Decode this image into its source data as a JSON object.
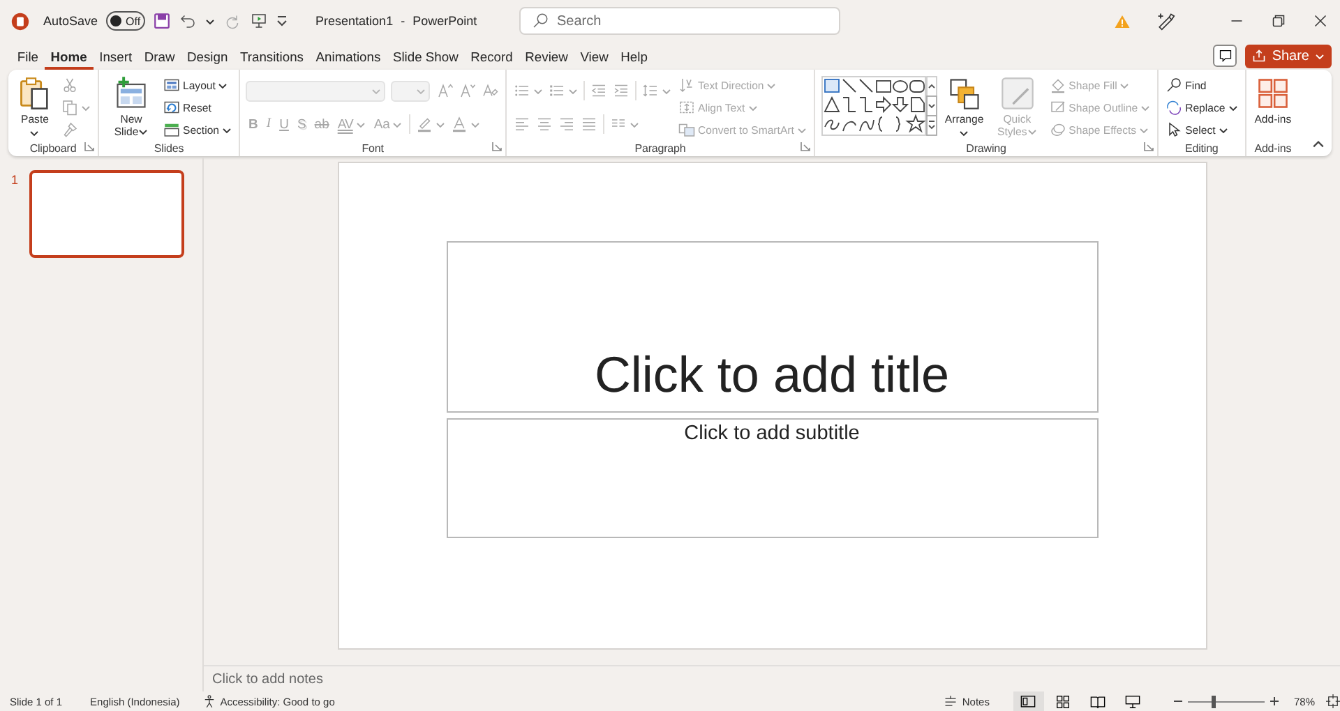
{
  "title_bar": {
    "autosave": {
      "label": "AutoSave",
      "on": false,
      "state_text": "Off"
    },
    "title": "Presentation1 - PowerPoint",
    "search": {
      "placeholder": "Search"
    }
  },
  "tabs": [
    {
      "label": "File",
      "selected": false
    },
    {
      "label": "Home",
      "selected": true
    },
    {
      "label": "Insert",
      "selected": false
    },
    {
      "label": "Draw",
      "selected": false
    },
    {
      "label": "Design",
      "selected": false
    },
    {
      "label": "Transitions",
      "selected": false
    },
    {
      "label": "Animations",
      "selected": false
    },
    {
      "label": "Slide Show",
      "selected": false
    },
    {
      "label": "Record",
      "selected": false
    },
    {
      "label": "Review",
      "selected": false
    },
    {
      "label": "View",
      "selected": false
    },
    {
      "label": "Help",
      "selected": false
    }
  ],
  "share": {
    "label": "Share"
  },
  "ribbon": {
    "groups": [
      {
        "label": "Clipboard",
        "launcher": true,
        "columns": [
          [
            [
              {
                "kind": "large",
                "label": "Paste",
                "dropdown": true,
                "disabled": false
              }
            ]
          ],
          [
            [
              {
                "kind": "icon",
                "dropdown": false,
                "disabled": true
              }
            ],
            [
              {
                "kind": "icon",
                "dropdown": true,
                "disabled": true
              }
            ],
            [
              {
                "kind": "icon",
                "dropdown": false,
                "disabled": true
              }
            ]
          ]
        ]
      },
      {
        "label": "Slides",
        "launcher": false,
        "columns": [
          [
            [
              {
                "kind": "large",
                "label": "New Slide",
                "dropdown": true,
                "disabled": false
              }
            ]
          ],
          [
            [
              {
                "kind": "small",
                "label": "Layout",
                "dropdown": true,
                "disabled": false
              }
            ],
            [
              {
                "kind": "small",
                "label": "Reset",
                "dropdown": false,
                "disabled": false
              }
            ],
            [
              {
                "kind": "small",
                "label": "Section",
                "dropdown": true,
                "disabled": false
              }
            ]
          ]
        ]
      },
      {
        "label": "Font",
        "launcher": true,
        "columns": [
          [
            [
              {
                "kind": "combo",
                "dropdown": true,
                "disabled": true
              },
              {
                "kind": "combo",
                "dropdown": true,
                "disabled": true
              },
              {
                "kind": "icon",
                "dropdown": false,
                "disabled": true
              },
              {
                "kind": "icon",
                "dropdown": false,
                "disabled": true
              },
              {
                "kind": "icon",
                "dropdown": false,
                "disabled": true
              }
            ],
            [
              {
                "kind": "glyph",
                "label": "B",
                "dropdown": false,
                "disabled": true
              },
              {
                "kind": "glyph",
                "label": "I",
                "dropdown": false,
                "disabled": true
              },
              {
                "kind": "glyph",
                "label": "U",
                "dropdown": false,
                "disabled": true
              },
              {
                "kind": "glyph",
                "label": "S",
                "dropdown": false,
                "disabled": true
              },
              {
                "kind": "glyph",
                "label": "ab",
                "dropdown": false,
                "disabled": true
              },
              {
                "kind": "glyph",
                "label": "AV",
                "dropdown": true,
                "disabled": true
              },
              {
                "kind": "glyph",
                "label": "Aa",
                "dropdown": true,
                "disabled": true
              },
              {
                "kind": "sep"
              },
              {
                "kind": "icon",
                "dropdown": true,
                "disabled": true
              },
              {
                "kind": "icon",
                "dropdown": true,
                "disabled": true
              }
            ]
          ]
        ]
      },
      {
        "label": "Paragraph",
        "launcher": true,
        "columns": [
          [
            [
              {
                "kind": "icon",
                "dropdown": true,
                "disabled": true
              },
              {
                "kind": "icon",
                "dropdown": true,
                "disabled": true
              },
              {
                "kind": "sep"
              },
              {
                "kind": "icon",
                "dropdown": false,
                "disabled": true
              },
              {
                "kind": "icon",
                "dropdown": false,
                "disabled": true
              },
              {
                "kind": "sep"
              },
              {
                "kind": "icon",
                "dropdown": true,
                "disabled": true
              }
            ],
            [
              {
                "kind": "icon",
                "dropdown": false,
                "disabled": true
              },
              {
                "kind": "icon",
                "dropdown": false,
                "disabled": true
              },
              {
                "kind": "icon",
                "dropdown": false,
                "disabled": true
              },
              {
                "kind": "icon",
                "dropdown": false,
                "disabled": true
              },
              {
                "kind": "sep"
              },
              {
                "kind": "icon",
                "dropdown": true,
                "disabled": true
              }
            ]
          ],
          [
            [
              {
                "kind": "small",
                "label": "Text Direction",
                "dropdown": true,
                "disabled": true
              }
            ],
            [
              {
                "kind": "small",
                "label": "Align Text",
                "dropdown": true,
                "disabled": true
              }
            ],
            [
              {
                "kind": "small",
                "label": "Convert to SmartArt",
                "dropdown": true,
                "disabled": true
              }
            ]
          ]
        ]
      },
      {
        "label": "Drawing",
        "launcher": true,
        "columns": [
          [
            [
              {
                "kind": "gallery"
              }
            ]
          ],
          [
            [
              {
                "kind": "large",
                "label": "Arrange",
                "dropdown": true,
                "disabled": false
              }
            ]
          ],
          [
            [
              {
                "kind": "large",
                "label": "Quick Styles",
                "dropdown": true,
                "disabled": true
              }
            ]
          ],
          [
            [
              {
                "kind": "small",
                "label": "Shape Fill",
                "dropdown": true,
                "disabled": true
              }
            ],
            [
              {
                "kind": "small",
                "label": "Shape Outline",
                "dropdown": true,
                "disabled": true
              }
            ],
            [
              {
                "kind": "small",
                "label": "Shape Effects",
                "dropdown": true,
                "disabled": true
              }
            ]
          ]
        ]
      },
      {
        "label": "Editing",
        "launcher": false,
        "columns": [
          [
            [
              {
                "kind": "small",
                "label": "Find",
                "dropdown": false,
                "disabled": false
              }
            ],
            [
              {
                "kind": "small",
                "label": "Replace",
                "dropdown": true,
                "disabled": false
              }
            ],
            [
              {
                "kind": "small",
                "label": "Select",
                "dropdown": true,
                "disabled": false
              }
            ]
          ]
        ]
      },
      {
        "label": "Add-ins",
        "launcher": false,
        "columns": [
          [
            [
              {
                "kind": "large",
                "label": "Add-ins",
                "dropdown": false,
                "disabled": false
              }
            ]
          ]
        ]
      }
    ]
  },
  "slides_panel": {
    "slides": [
      {
        "number": "1",
        "selected": true
      }
    ]
  },
  "slide": {
    "title_placeholder": "Click to add title",
    "subtitle_placeholder": "Click to add subtitle"
  },
  "notes": {
    "placeholder": "Click to add notes"
  },
  "status_bar": {
    "slide_info": "Slide 1 of 1",
    "language": "English (Indonesia)",
    "accessibility": "Accessibility: Good to go",
    "notes_button": "Notes",
    "views": [
      {
        "selected": true
      },
      {
        "selected": false
      },
      {
        "selected": false
      },
      {
        "selected": false
      }
    ],
    "zoom": {
      "level": 0.33,
      "reading": "78%"
    }
  }
}
